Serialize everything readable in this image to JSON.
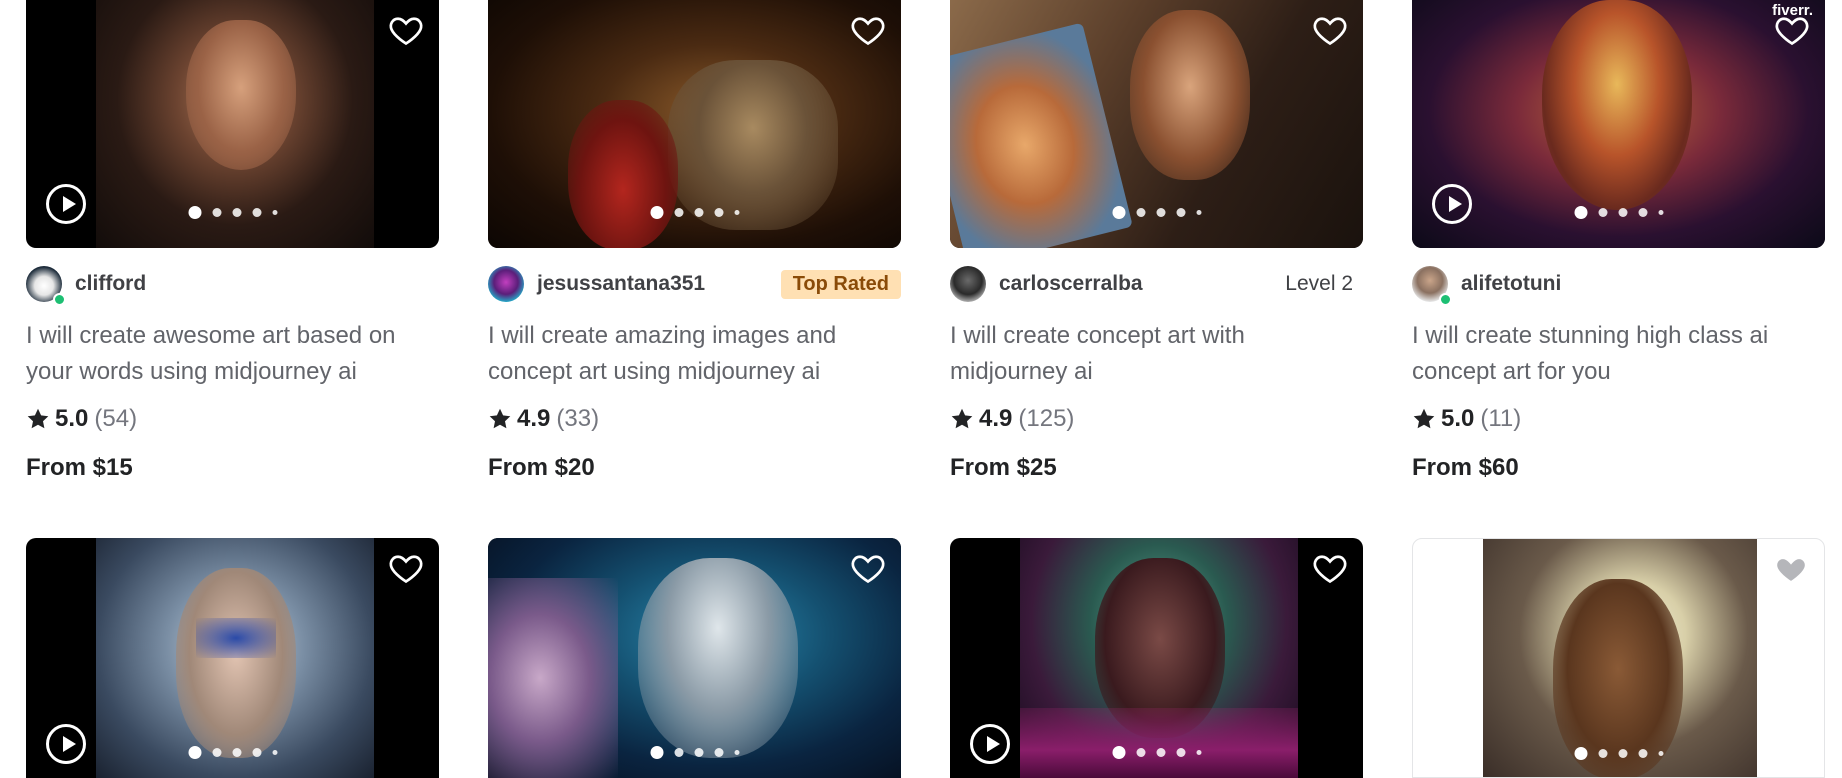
{
  "gigs": [
    {
      "seller": "clifford",
      "badge": "",
      "title": "I will create awesome art based on your words using midjourney ai",
      "rating": "5.0",
      "reviews": "(54)",
      "price": "From $15"
    },
    {
      "seller": "jesussantana351",
      "badge": "Top Rated",
      "title": "I will create amazing images and concept art using midjourney ai",
      "rating": "4.9",
      "reviews": "(33)",
      "price": "From $20"
    },
    {
      "seller": "carloscerralba",
      "badge": "Level 2",
      "title": "I will create concept art with midjourney ai",
      "rating": "4.9",
      "reviews": "(125)",
      "price": "From $25"
    },
    {
      "seller": "alifetotuni",
      "badge": "",
      "title": "I will create stunning high class ai concept art for you",
      "rating": "5.0",
      "reviews": "(11)",
      "price": "From $60"
    }
  ],
  "watermark": "fiverr.",
  "icons": {
    "favorite": "heart-icon",
    "play": "play-icon",
    "rating": "star-icon"
  },
  "colors": {
    "top_rated_bg": "#ffe0b3",
    "top_rated_text": "#8a4b08",
    "online": "#1dbf73"
  }
}
